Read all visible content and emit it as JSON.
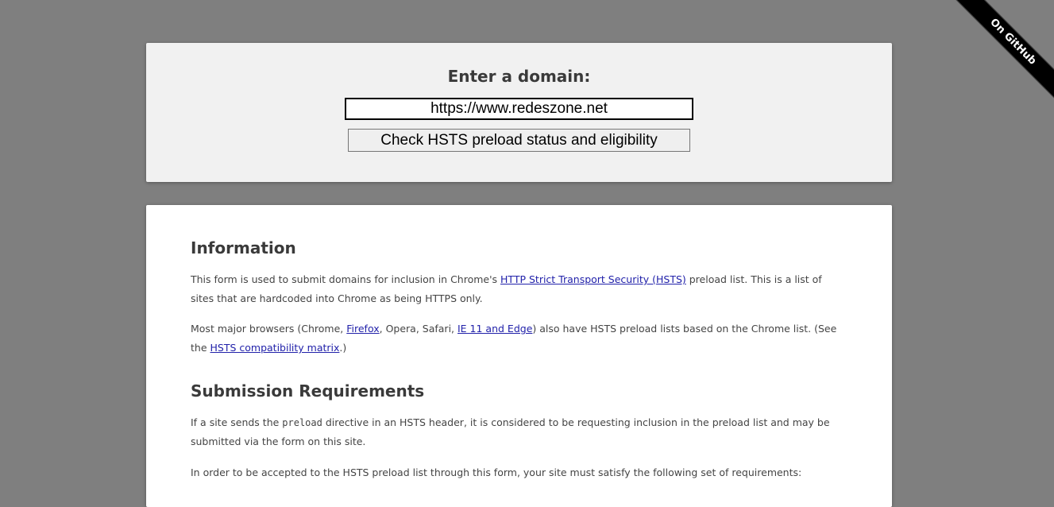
{
  "ribbon": {
    "label": "On GitHub"
  },
  "form": {
    "title": "Enter a domain:",
    "domain_value": "https://www.redeszone.net",
    "button_label": "Check HSTS preload status and eligibility"
  },
  "information": {
    "heading": "Information",
    "p1": {
      "before": "This form is used to submit domains for inclusion in Chrome's ",
      "link": "HTTP Strict Transport Security (HSTS)",
      "after": " preload list. This is a list of sites that are hardcoded into Chrome as being HTTPS only."
    },
    "p2": {
      "t1": "Most major browsers (Chrome, ",
      "link_firefox": "Firefox",
      "t2": ", Opera, Safari, ",
      "link_ie": "IE 11 and Edge",
      "t3": ") also have HSTS preload lists based on the Chrome list. (See the ",
      "link_matrix": "HSTS compatibility matrix",
      "t4": ".)"
    }
  },
  "requirements": {
    "heading": "Submission Requirements",
    "p1": {
      "before": "If a site sends the ",
      "code": "preload",
      "after": " directive in an HSTS header, it is considered to be requesting inclusion in the preload list and may be submitted via the form on this site."
    },
    "p2": "In order to be accepted to the HSTS preload list through this form, your site must satisfy the following set of requirements:"
  }
}
